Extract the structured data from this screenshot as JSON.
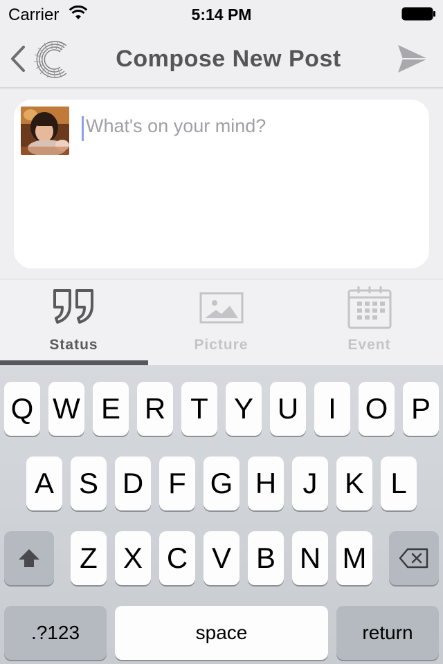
{
  "status_bar": {
    "carrier": "Carrier",
    "time": "5:14 PM"
  },
  "nav": {
    "title": "Compose New Post",
    "back_icon": "chevron-left-icon",
    "logo_icon": "app-logo-icon",
    "send_icon": "paper-plane-icon"
  },
  "compose": {
    "placeholder": "What's on your mind?",
    "value": ""
  },
  "tabs": [
    {
      "label": "Status",
      "icon": "quote-icon",
      "active": true
    },
    {
      "label": "Picture",
      "icon": "picture-icon",
      "active": false
    },
    {
      "label": "Event",
      "icon": "calendar-icon",
      "active": false
    }
  ],
  "keyboard": {
    "row1": [
      "Q",
      "W",
      "E",
      "R",
      "T",
      "Y",
      "U",
      "I",
      "O",
      "P"
    ],
    "row2": [
      "A",
      "S",
      "D",
      "F",
      "G",
      "H",
      "J",
      "K",
      "L"
    ],
    "row3": [
      "Z",
      "X",
      "C",
      "V",
      "B",
      "N",
      "M"
    ],
    "numbers_label": ".?123",
    "space_label": "space",
    "return_label": "return",
    "shift_icon": "shift-icon",
    "delete_icon": "backspace-icon"
  },
  "colors": {
    "accent_gray": "#58585c",
    "inactive_gray": "#c4c4c8",
    "caret": "#8aa0e8",
    "send_icon": "#a9a9ad"
  }
}
